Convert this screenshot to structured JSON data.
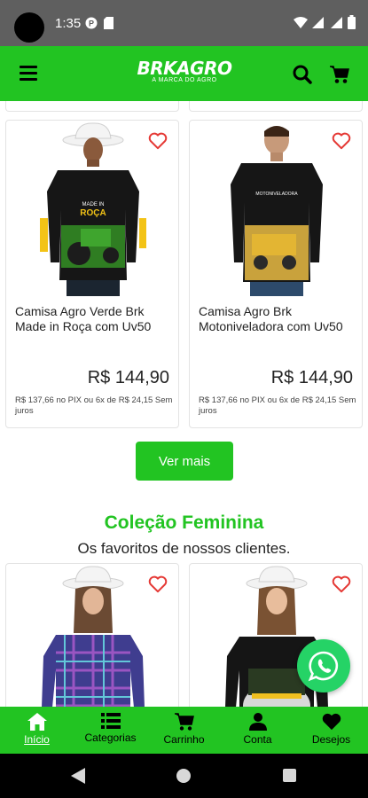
{
  "status_bar": {
    "time": "1:35"
  },
  "header": {
    "brand_logo": "BRKAGRO",
    "brand_tagline": "A MARCA DO AGRO"
  },
  "products": [
    {
      "name": "Camisa Agro Verde Brk Made in Roça com Uv50",
      "price": "R$ 144,90",
      "installment": "R$ 137,66 no PIX ou 6x de R$ 24,15 Sem juros",
      "print_text": "MADE IN ROÇA"
    },
    {
      "name": "Camisa Agro Brk Motoniveladora com Uv50",
      "price": "R$ 144,90",
      "installment": "R$ 137,66 no PIX ou 6x de R$ 24,15 Sem juros",
      "print_text": ""
    }
  ],
  "ver_mais_label": "Ver mais",
  "collection": {
    "title": "Coleção Feminina",
    "subtitle": "Os favoritos de nossos clientes."
  },
  "bottom_nav": [
    {
      "label": "Início",
      "icon": "home-icon",
      "active": true
    },
    {
      "label": "Categorias",
      "icon": "list-icon",
      "active": false
    },
    {
      "label": "Carrinho",
      "icon": "cart-icon",
      "active": false
    },
    {
      "label": "Conta",
      "icon": "user-icon",
      "active": false
    },
    {
      "label": "Desejos",
      "icon": "heart-icon",
      "active": false
    }
  ],
  "colors": {
    "brand_green": "#22c422",
    "whatsapp_green": "#25d366",
    "heart_red": "#e53935"
  }
}
